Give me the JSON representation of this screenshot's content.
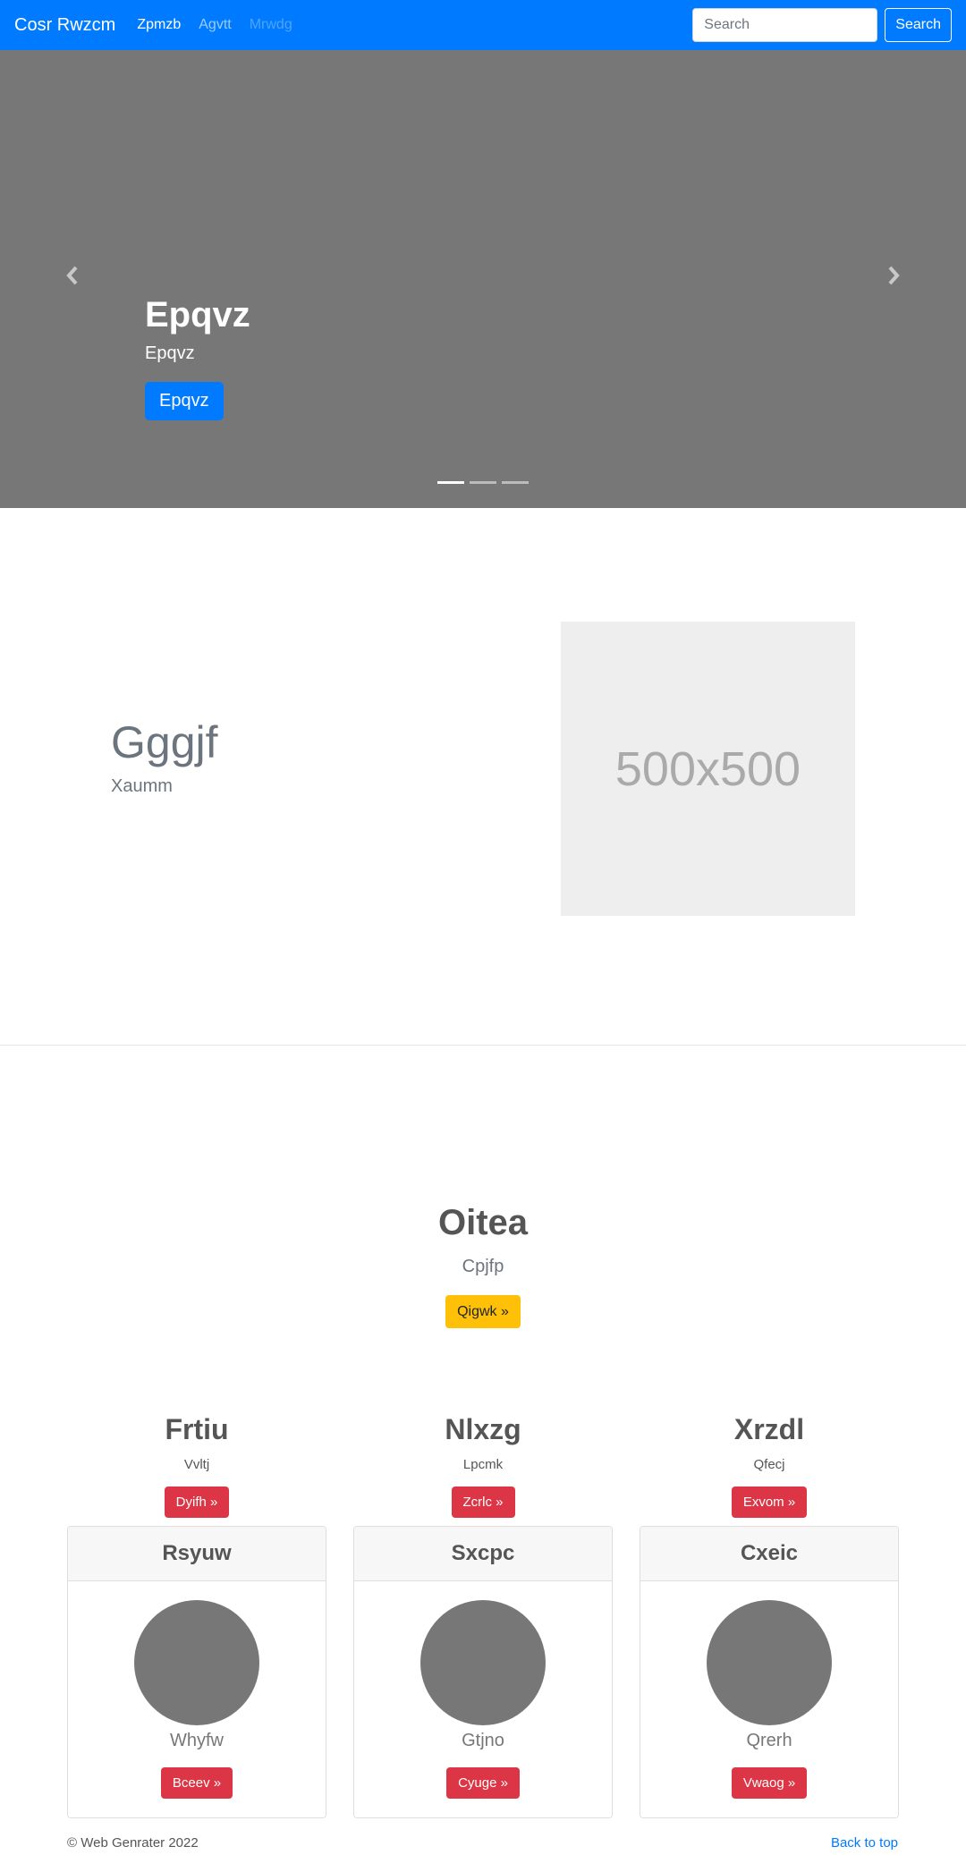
{
  "navbar": {
    "brand": "Cosr Rwzcm",
    "links": [
      {
        "label": "Zpmzb",
        "state": "active"
      },
      {
        "label": "Agvtt",
        "state": "normal"
      },
      {
        "label": "Mrwdg",
        "state": "disabled"
      }
    ],
    "search_placeholder": "Search",
    "search_button": "Search"
  },
  "carousel": {
    "title": "Epqvz",
    "subtitle": "Epqvz",
    "button": "Epqvz",
    "slide_count": 3,
    "active_slide": 1,
    "prev_icon": "chevron-left-icon",
    "next_icon": "chevron-right-icon"
  },
  "featurette": {
    "heading": "Gggjf",
    "subheading": "Xaumm",
    "image_label": "500x500"
  },
  "jumbotron": {
    "title": "Oitea",
    "subtitle": "Cpjfp",
    "button": "Qigwk »"
  },
  "columns": [
    {
      "title": "Frtiu",
      "text": "Vvltj",
      "button": "Dyifh »"
    },
    {
      "title": "Nlxzg",
      "text": "Lpcmk",
      "button": "Zcrlc »"
    },
    {
      "title": "Xrzdl",
      "text": "Qfecj",
      "button": "Exvom »"
    }
  ],
  "cards": [
    {
      "header": "Rsyuw",
      "name": "Whyfw",
      "button": "Bceev »"
    },
    {
      "header": "Sxcpc",
      "name": "Gtjno",
      "button": "Cyuge »"
    },
    {
      "header": "Cxeic",
      "name": "Qrerh",
      "button": "Vwaog »"
    }
  ],
  "footer": {
    "copyright": "© Web Genrater 2022",
    "back_to_top": "Back to top"
  },
  "colors": {
    "primary": "#007bff",
    "danger": "#dc3545",
    "warning": "#ffc107",
    "carousel_bg": "#777777"
  }
}
